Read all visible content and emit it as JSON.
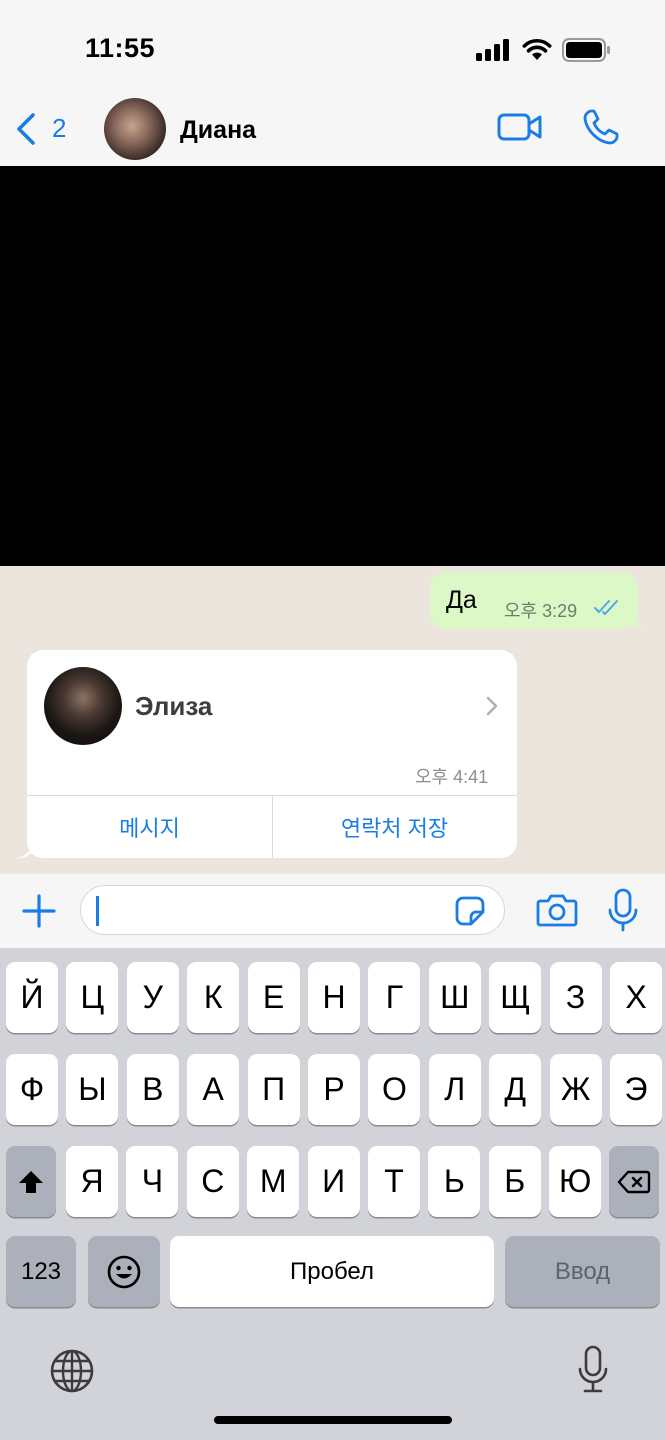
{
  "status_bar": {
    "time": "11:55",
    "icons": [
      "cellular-signal-icon",
      "wifi-icon",
      "battery-icon"
    ]
  },
  "nav": {
    "back_count": "2",
    "contact_name": "Диана",
    "icons": [
      "chevron-left-icon",
      "video-camera-icon",
      "phone-icon"
    ]
  },
  "messages": {
    "outgoing": {
      "text": "Да",
      "time": "오후 3:29",
      "status_icon": "double-check-icon"
    },
    "contact_card": {
      "name": "Элиза",
      "time": "오후 4:41",
      "message_button": "메시지",
      "save_button": "연락처 저장"
    }
  },
  "input_bar": {
    "icons": [
      "plus-icon",
      "sticker-icon",
      "camera-icon",
      "microphone-icon"
    ]
  },
  "keyboard": {
    "row1": [
      "Й",
      "Ц",
      "У",
      "К",
      "Е",
      "Н",
      "Г",
      "Ш",
      "Щ",
      "З",
      "Х"
    ],
    "row2": [
      "Ф",
      "Ы",
      "В",
      "А",
      "П",
      "Р",
      "О",
      "Л",
      "Д",
      "Ж",
      "Э"
    ],
    "row3": [
      "Я",
      "Ч",
      "С",
      "М",
      "И",
      "Т",
      "Ь",
      "Б",
      "Ю"
    ],
    "numbers_key": "123",
    "space_key": "Пробел",
    "return_key": "Ввод",
    "icons": [
      "shift-icon",
      "backspace-icon",
      "emoji-icon",
      "globe-icon",
      "dictation-icon"
    ]
  },
  "colors": {
    "accent": "#1a7de3",
    "outgoing_bubble": "#dcf8c6",
    "chat_background": "#ece5dd",
    "keyboard_background": "#d1d3d9"
  }
}
